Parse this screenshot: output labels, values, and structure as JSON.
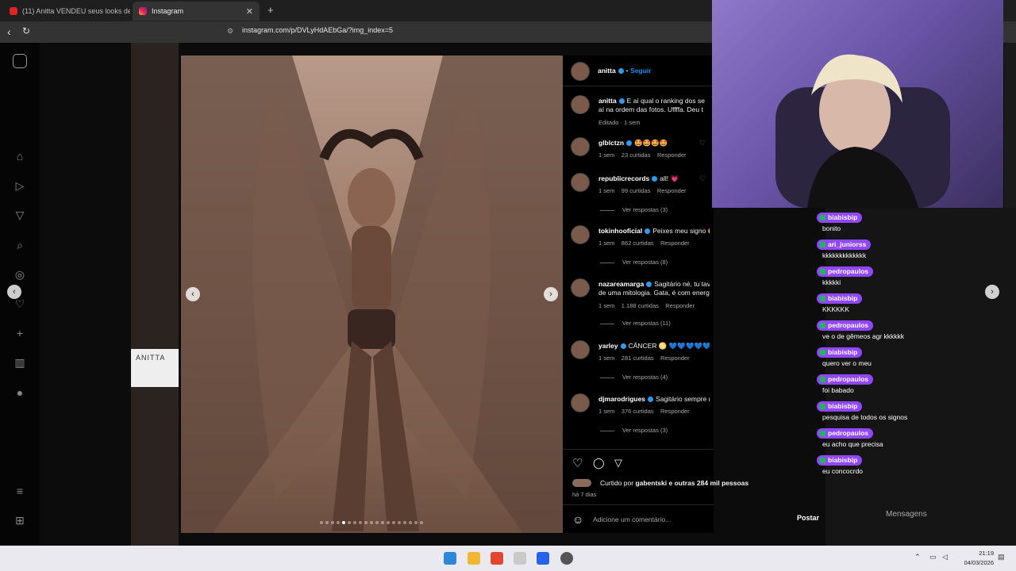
{
  "browser": {
    "tabs": [
      {
        "label": "(11) Anitta VENDEU seus looks de ca",
        "active": false
      },
      {
        "label": "Instagram",
        "active": true
      }
    ],
    "url": "instagram.com/p/DVLyHdAEbGa/?img_index=5",
    "new_tab": "+"
  },
  "post": {
    "author": "anitta",
    "follow_label": "Seguir",
    "caption_user": "anitta",
    "caption_line1": "E aí qual o ranking dos se",
    "caption_line2": "aí na ordem das fotos. Uffffa. Deu t",
    "caption_meta": "Editado · 1 sem",
    "liked_by": "Curtido por",
    "liked_user": "gabentski",
    "liked_rest": "e outras 284 mil pessoas",
    "time_ago": "há 7 dias",
    "comment_placeholder": "Adicione um comentário...",
    "post_button": "Postar",
    "side_label": "ANITTA"
  },
  "comments": [
    {
      "user": "glblctzn",
      "text": "🤩🤩🤩🤩",
      "time": "1 sem",
      "likes": "23 curtidas",
      "reply": "Responder",
      "replies": ""
    },
    {
      "user": "republicrecords",
      "text": "all! 💗",
      "time": "1 sem",
      "likes": "99 curtidas",
      "reply": "Responder",
      "replies": "Ver respostas (3)"
    },
    {
      "user": "tokinhooficial",
      "text": "Peixes meu signo 🤩🤩✨",
      "time": "1 sem",
      "likes": "862 curtidas",
      "reply": "Responder",
      "replies": "Ver respostas (8)"
    },
    {
      "user": "nazareamarga",
      "text": "Sagitário né, tu tava parecendo uma Deusa",
      "text2": "de uma mitologia. Gata, é com energia de entidade. AMO ❤️",
      "time": "1 sem",
      "likes": "1.188 curtidas",
      "reply": "Responder",
      "replies": "Ver respostas (11)"
    },
    {
      "user": "yarley",
      "text": "CÂNCER ♋ 💙💙💙💙💙💙💙💙",
      "time": "1 sem",
      "likes": "281 curtidas",
      "reply": "Responder",
      "replies": "Ver respostas (4)"
    },
    {
      "user": "djmarodrigues",
      "text": "Sagitário sempre reizinho 👑🏹🤩",
      "time": "1 sem",
      "likes": "376 curtidas",
      "reply": "Responder",
      "replies": "Ver respostas (3)"
    }
  ],
  "chat": [
    {
      "user": "biabisbip",
      "msg": "bonito"
    },
    {
      "user": "ari_juniorss",
      "msg": "kkkkkkkkkkkkk"
    },
    {
      "user": "pedropaulos",
      "msg": "kkkkki"
    },
    {
      "user": "biabisbip",
      "msg": "KKKKKK"
    },
    {
      "user": "pedropaulos",
      "msg": "ve o de gêmeos agr kkkkkk"
    },
    {
      "user": "biabisbip",
      "msg": "quero ver o meu"
    },
    {
      "user": "pedropaulos",
      "msg": "foi babado"
    },
    {
      "user": "biabisbip",
      "msg": "pesquisa de todos os signos"
    },
    {
      "user": "pedropaulos",
      "msg": "eu acho que precisa"
    },
    {
      "user": "biabisbip",
      "msg": "eu concocrdo"
    }
  ],
  "messages_label": "Mensagens",
  "taskbar": {
    "time": "21:19",
    "date": "04/03/2026"
  },
  "colors": {
    "accent": "#9147ff",
    "verified": "#2f9bf0",
    "link": "#0095f6"
  }
}
